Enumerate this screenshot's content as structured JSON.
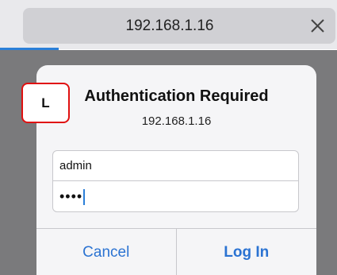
{
  "browser": {
    "url": "192.168.1.16",
    "close_icon": "close-icon",
    "accent_color": "#2b7fd8"
  },
  "dialog": {
    "title": "Authentication Required",
    "subtitle": "192.168.1.16",
    "username_value": "admin",
    "password_masked": "••••",
    "cancel_label": "Cancel",
    "login_label": "Log In"
  },
  "annotation": {
    "label": "L",
    "border_color": "#e01010"
  }
}
